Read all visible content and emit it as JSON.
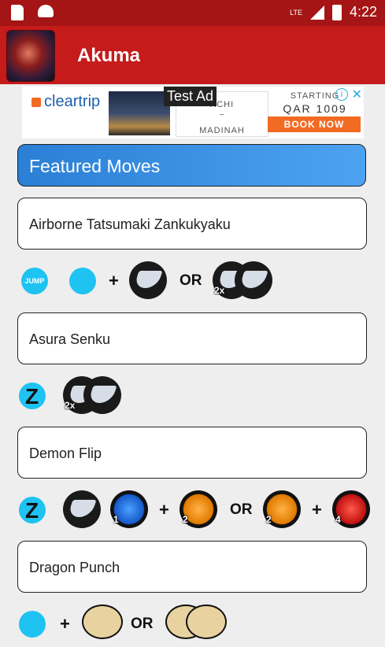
{
  "status_bar": {
    "network": "LTE",
    "time": "4:22"
  },
  "app": {
    "title": "Akuma"
  },
  "ad": {
    "brand": "cleartrip",
    "label": "Test Ad",
    "city_line1": "ACHI",
    "city_line2": "MADINAH",
    "starting": "STARTING",
    "fare": "QAR 1009",
    "cta": "BOOK NOW"
  },
  "section": {
    "title": "Featured Moves"
  },
  "moves": [
    {
      "name": "Airborne Tatsumaki Zankukyaku"
    },
    {
      "name": "Asura Senku"
    },
    {
      "name": "Demon Flip"
    },
    {
      "name": "Dragon Punch"
    }
  ],
  "inputs": {
    "jump": "JUMP",
    "or": "OR",
    "plus": "+",
    "x2": "2x",
    "n1": "1",
    "n2": "2",
    "n4": "4"
  },
  "colors": {
    "status_bar": "#a51515",
    "app_bar": "#c51b1b",
    "header_blue": "#2b7fd5",
    "cyan_button": "#1ec3f2"
  }
}
